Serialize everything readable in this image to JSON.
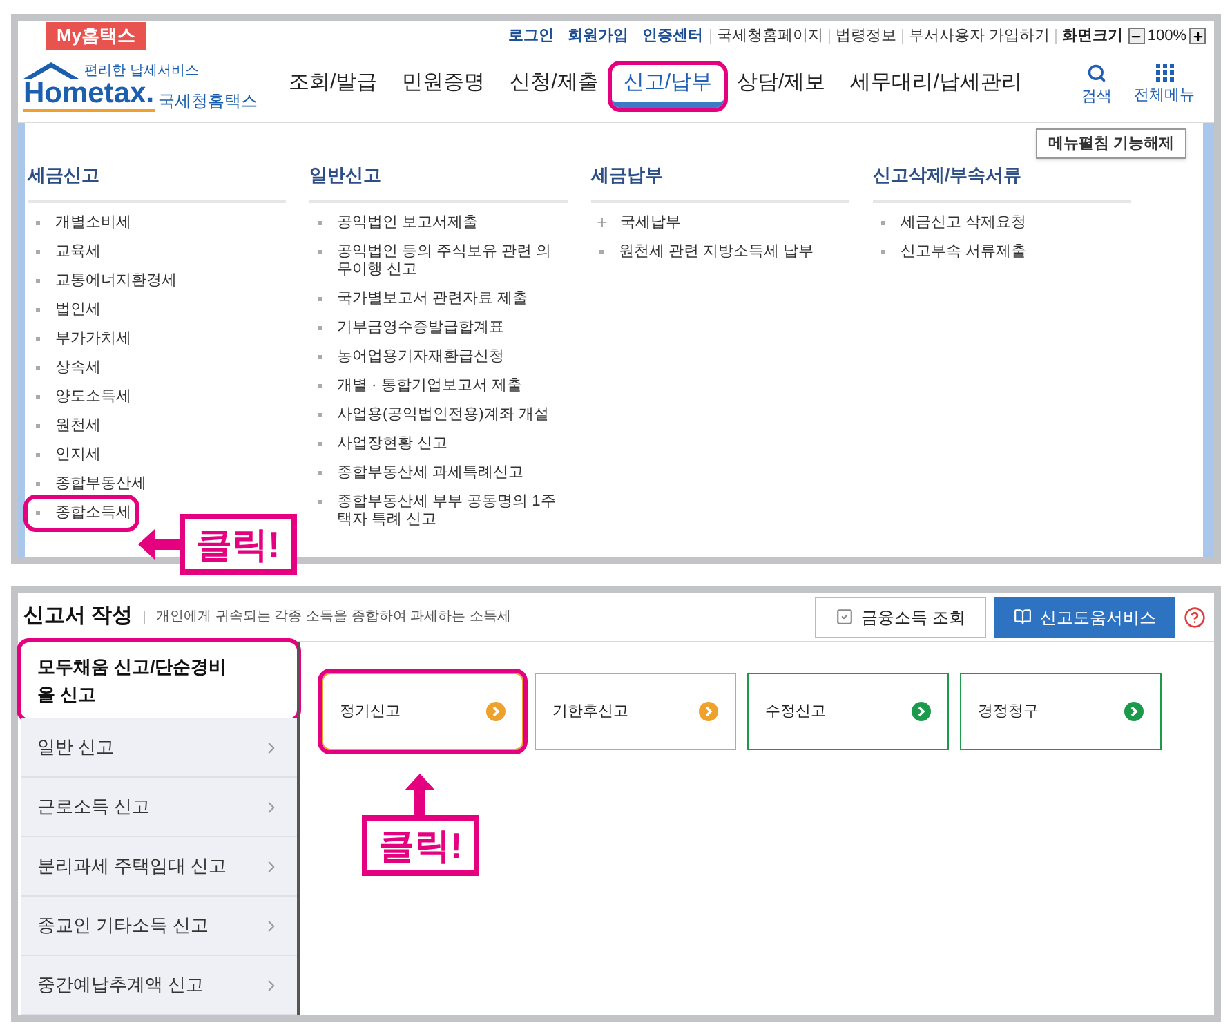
{
  "top_screen": {
    "my_tab": "My홈택스",
    "util_links": [
      {
        "label": "로그인",
        "kind": "strong"
      },
      {
        "label": "회원가입",
        "kind": "strong"
      },
      {
        "label": "인증센터",
        "kind": "strong"
      },
      {
        "label": "국세청홈페이지",
        "kind": "plain"
      },
      {
        "label": "법령정보",
        "kind": "plain"
      },
      {
        "label": "부서사용자 가입하기",
        "kind": "plain"
      }
    ],
    "zoom_label": "화면크기",
    "zoom_value": "100%",
    "logo": {
      "tagline": "편리한 납세서비스",
      "brand": "Hometax.",
      "name": "국세청홈택스"
    },
    "nav": [
      {
        "label": "조회/발급",
        "selected": false,
        "highlighted": false
      },
      {
        "label": "민원증명",
        "selected": false,
        "highlighted": false
      },
      {
        "label": "신청/제출",
        "selected": false,
        "highlighted": false
      },
      {
        "label": "신고/납부",
        "selected": true,
        "highlighted": true
      },
      {
        "label": "상담/제보",
        "selected": false,
        "highlighted": false
      },
      {
        "label": "세무대리/납세관리",
        "selected": false,
        "highlighted": false
      }
    ],
    "tools": [
      {
        "label": "검색",
        "kind": "search"
      },
      {
        "label": "전체메뉴",
        "kind": "grid"
      }
    ],
    "collapse_button": "메뉴펼침 기능해제",
    "menu_columns": [
      {
        "heading": "세금신고",
        "items": [
          {
            "label": "개별소비세",
            "kind": "dot",
            "highlighted": false
          },
          {
            "label": "교육세",
            "kind": "dot",
            "highlighted": false
          },
          {
            "label": "교통에너지환경세",
            "kind": "dot",
            "highlighted": false
          },
          {
            "label": "법인세",
            "kind": "dot",
            "highlighted": false
          },
          {
            "label": "부가가치세",
            "kind": "dot",
            "highlighted": false
          },
          {
            "label": "상속세",
            "kind": "dot",
            "highlighted": false
          },
          {
            "label": "양도소득세",
            "kind": "dot",
            "highlighted": false
          },
          {
            "label": "원천세",
            "kind": "dot",
            "highlighted": false
          },
          {
            "label": "인지세",
            "kind": "dot",
            "highlighted": false
          },
          {
            "label": "종합부동산세",
            "kind": "dot",
            "highlighted": false
          },
          {
            "label": "종합소득세",
            "kind": "dot",
            "highlighted": true
          }
        ]
      },
      {
        "heading": "일반신고",
        "items": [
          {
            "label": "공익법인 보고서제출",
            "kind": "dot",
            "highlighted": false
          },
          {
            "label": "공익법인 등의 주식보유 관련 의무이행 신고",
            "kind": "dot",
            "highlighted": false
          },
          {
            "label": "국가별보고서 관련자료 제출",
            "kind": "dot",
            "highlighted": false
          },
          {
            "label": "기부금영수증발급합계표",
            "kind": "dot",
            "highlighted": false
          },
          {
            "label": "농어업용기자재환급신청",
            "kind": "dot",
            "highlighted": false
          },
          {
            "label": "개별 · 통합기업보고서 제출",
            "kind": "dot",
            "highlighted": false
          },
          {
            "label": "사업용(공익법인전용)계좌 개설",
            "kind": "dot",
            "highlighted": false
          },
          {
            "label": "사업장현황 신고",
            "kind": "dot",
            "highlighted": false
          },
          {
            "label": "종합부동산세 과세특례신고",
            "kind": "dot",
            "highlighted": false
          },
          {
            "label": "종합부동산세 부부 공동명의 1주택자 특례 신고",
            "kind": "dot",
            "highlighted": false
          }
        ]
      },
      {
        "heading": "세금납부",
        "items": [
          {
            "label": "국세납부",
            "kind": "plus",
            "highlighted": false
          },
          {
            "label": "원천세 관련 지방소득세 납부",
            "kind": "dot",
            "highlighted": false
          }
        ]
      },
      {
        "heading": "신고삭제/부속서류",
        "items": [
          {
            "label": "세금신고 삭제요청",
            "kind": "dot",
            "highlighted": false
          },
          {
            "label": "신고부속 서류제출",
            "kind": "dot",
            "highlighted": false
          }
        ]
      }
    ],
    "callout": {
      "text": "클릭!",
      "kind": "left"
    }
  },
  "bottom_screen": {
    "title": "신고서 작성",
    "description": "개인에게 귀속되는 각종 소득을 종합하여 과세하는 소득세",
    "buttons": [
      {
        "label": "금융소득 조회",
        "kind": "outline"
      },
      {
        "label": "신고도움서비스",
        "kind": "primary"
      }
    ],
    "sidebar": [
      {
        "label": "모두채움 신고/단순경비율 신고",
        "selected": true,
        "highlighted": true
      },
      {
        "label": "일반 신고",
        "selected": false,
        "highlighted": false
      },
      {
        "label": "근로소득 신고",
        "selected": false,
        "highlighted": false
      },
      {
        "label": "분리과세 주택임대 신고",
        "selected": false,
        "highlighted": false
      },
      {
        "label": "종교인 기타소득 신고",
        "selected": false,
        "highlighted": false
      },
      {
        "label": "중간예납추계액 신고",
        "selected": false,
        "highlighted": false
      }
    ],
    "cards": [
      {
        "label": "정기신고",
        "color": "#eea12b",
        "highlighted": true
      },
      {
        "label": "기한후신고",
        "color": "#eea12b",
        "highlighted": false
      },
      {
        "label": "수정신고",
        "color": "#1c9a4c",
        "highlighted": false
      },
      {
        "label": "경정청구",
        "color": "#1c9a4c",
        "highlighted": false
      }
    ],
    "callout": {
      "text": "클릭!",
      "kind": "up"
    }
  }
}
